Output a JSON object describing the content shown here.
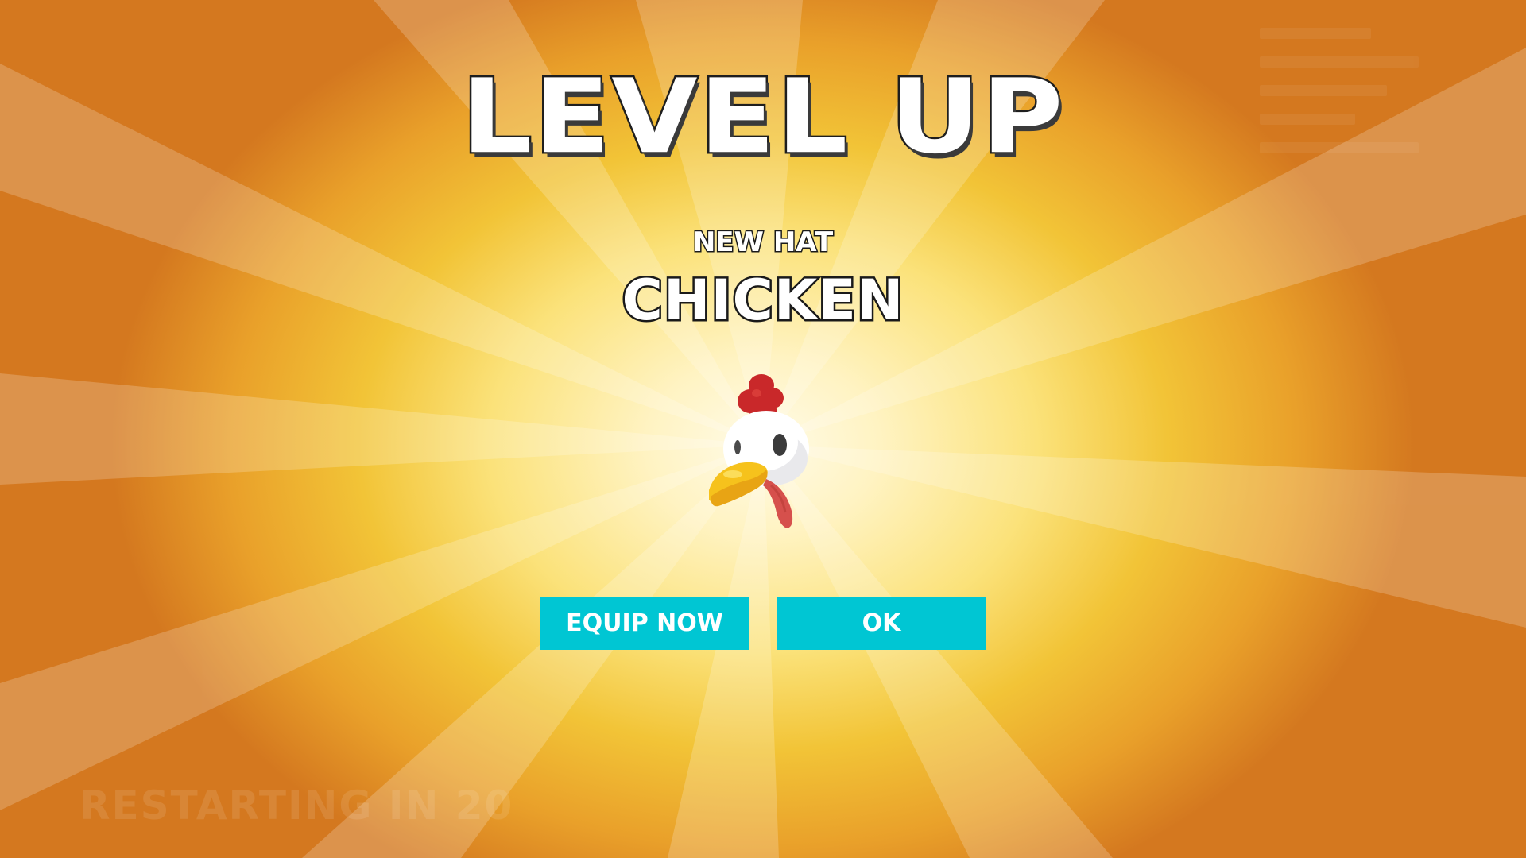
{
  "overlay": {
    "heading": "LEVEL UP",
    "reward_label": "NEW HAT",
    "reward_name": "CHICKEN",
    "reward_icon": "chicken-hat-icon"
  },
  "buttons": {
    "equip_label": "EQUIP NOW",
    "ok_label": "OK"
  },
  "background_hud": {
    "restart_text": "RESTARTING IN 20"
  },
  "colors": {
    "button": "#00c6d3",
    "text": "#ffffff",
    "text_outline": "#1e1e1e",
    "glow_center": "#fffbe8",
    "glow_edge": "#d4781f"
  }
}
